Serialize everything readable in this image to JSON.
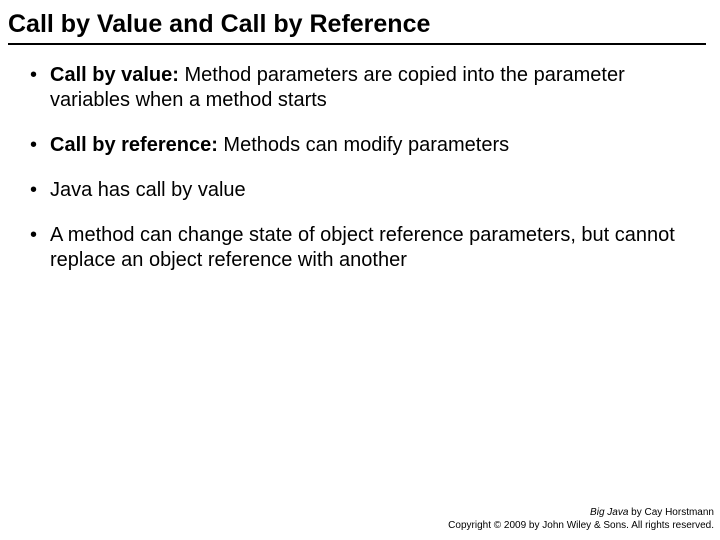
{
  "title": "Call by Value and Call by Reference",
  "bullets": [
    {
      "strong": "Call by value:",
      "rest": " Method parameters are copied into the parameter variables when a method starts"
    },
    {
      "strong": "Call by reference:",
      "rest": " Methods can modify parameters"
    },
    {
      "strong": "",
      "rest": "Java has call by value"
    },
    {
      "strong": "",
      "rest": "A method can change state of object reference parameters, but cannot replace an object reference with another"
    }
  ],
  "footer": {
    "book": "Big Java",
    "author_line": " by Cay Horstmann",
    "copyright": "Copyright © 2009 by John Wiley & Sons.  All rights reserved."
  }
}
